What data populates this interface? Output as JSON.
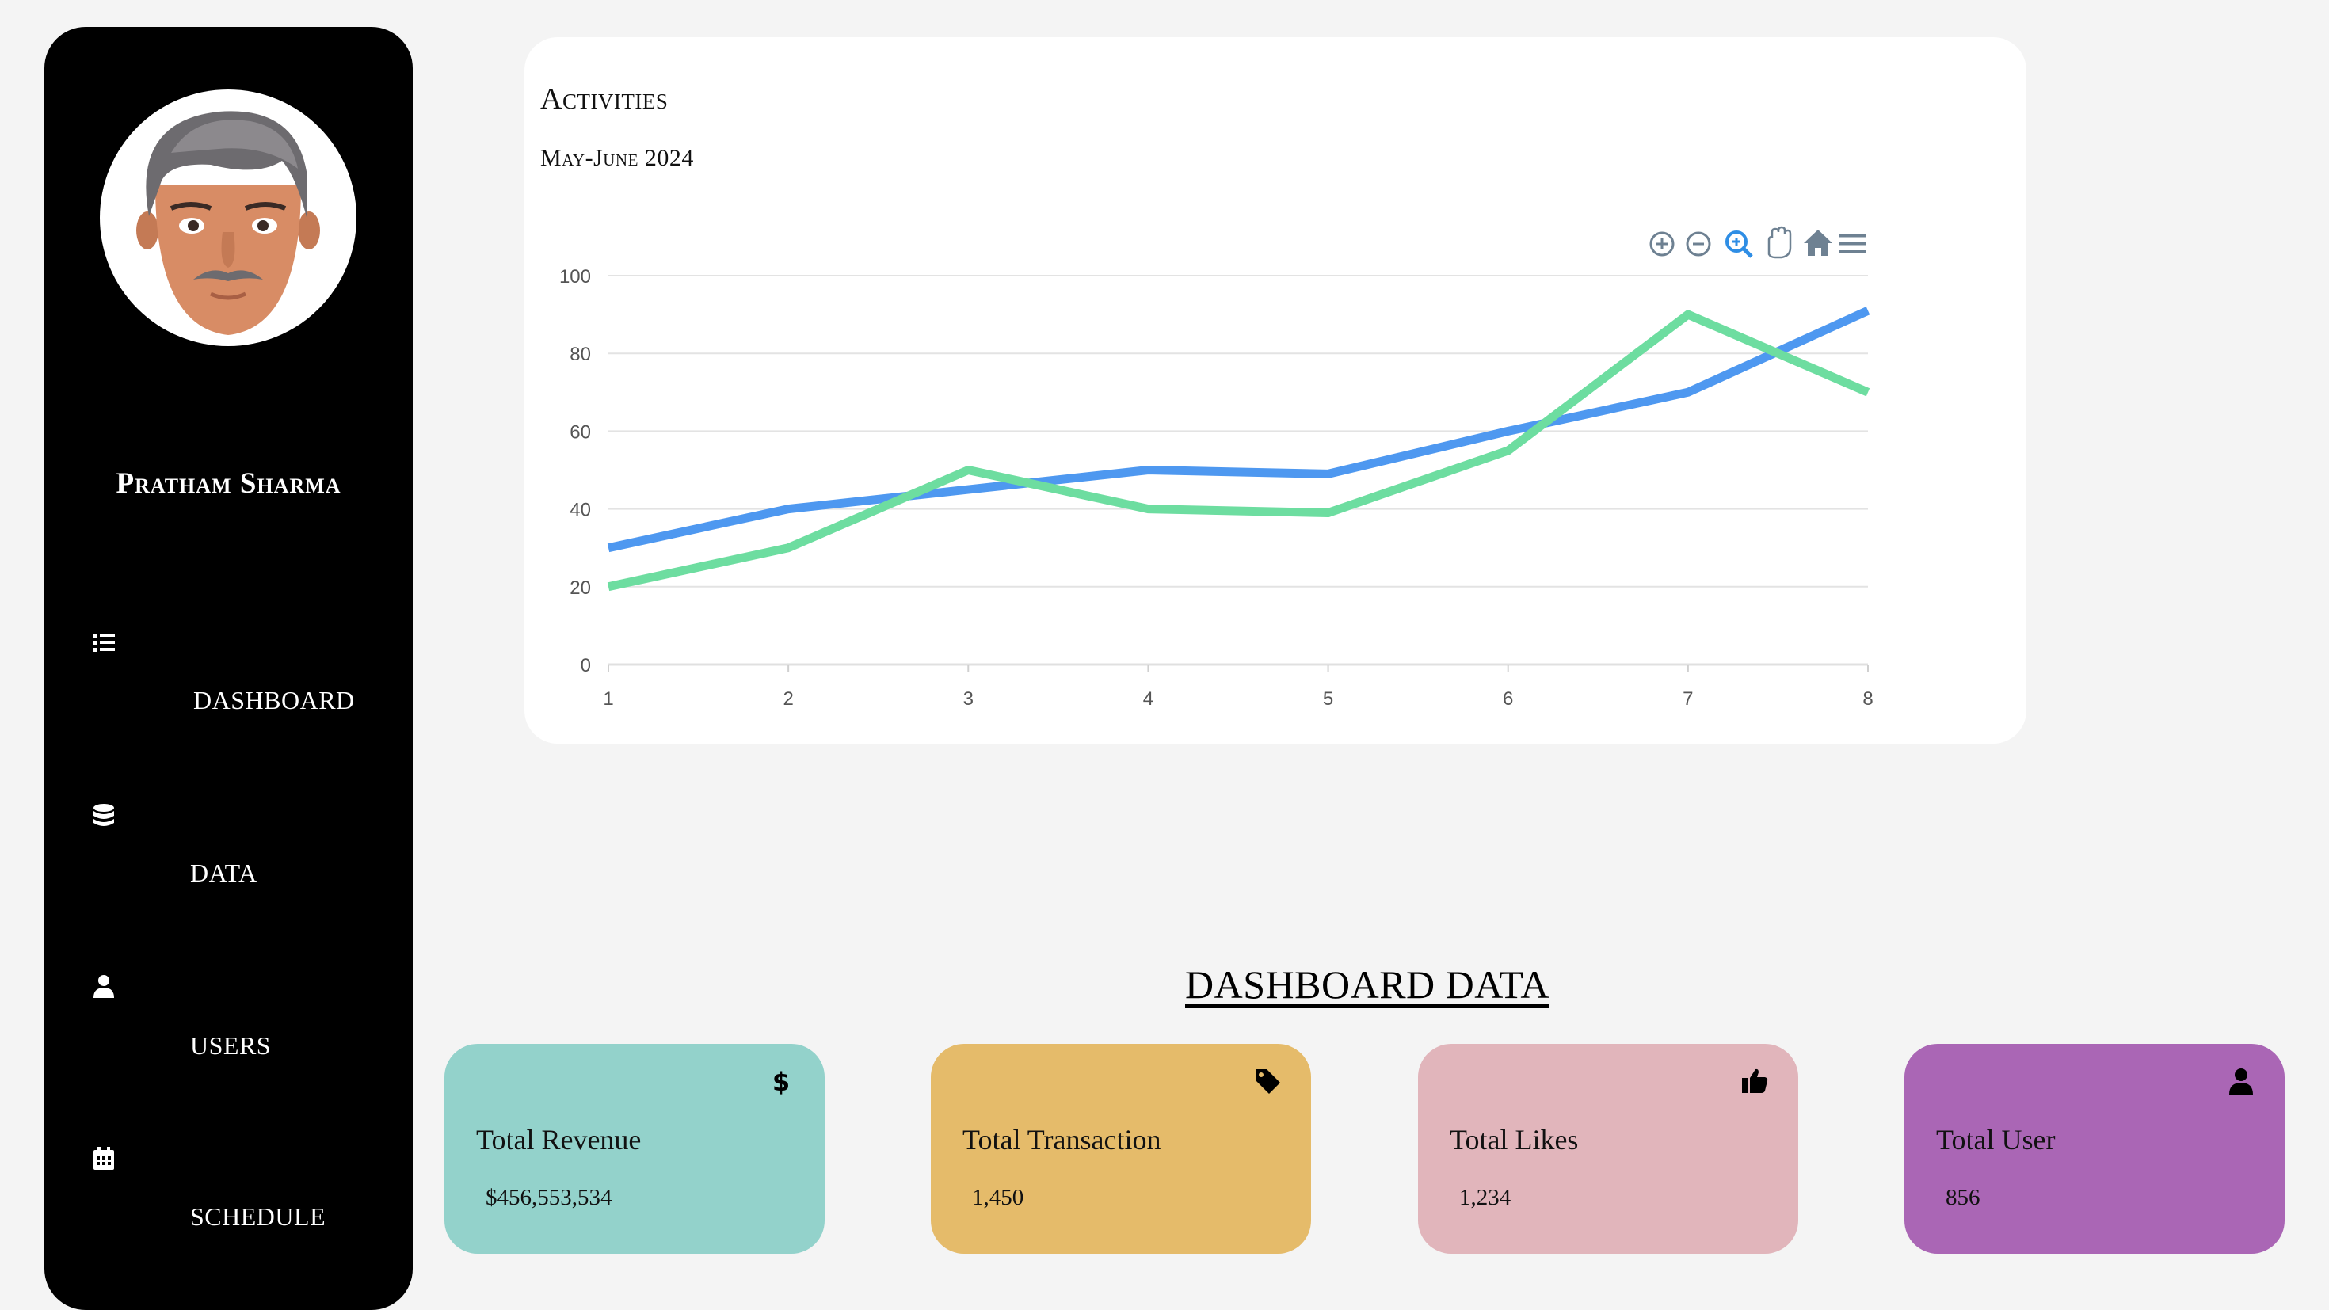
{
  "sidebar": {
    "profile_name": "Pratham Sharma",
    "items": [
      {
        "label": "DASHBOARD",
        "icon": "list-icon"
      },
      {
        "label": "DATA",
        "icon": "database-icon"
      },
      {
        "label": "USERS",
        "icon": "user-icon"
      },
      {
        "label": "SCHEDULE",
        "icon": "calendar-icon"
      }
    ]
  },
  "chart": {
    "title": "Activities",
    "subtitle": "May-June 2024",
    "toolbar": [
      "zoom-in-icon",
      "zoom-out-icon",
      "selection-zoom-icon",
      "pan-hand-icon",
      "home-reset-icon",
      "menu-icon"
    ]
  },
  "chart_data": {
    "type": "line",
    "x": [
      1,
      2,
      3,
      4,
      5,
      6,
      7,
      8
    ],
    "series": [
      {
        "color": "#4e98f0",
        "values": [
          30,
          40,
          45,
          50,
          49,
          60,
          70,
          91
        ]
      },
      {
        "color": "#6ddda0",
        "values": [
          20,
          30,
          50,
          40,
          39,
          55,
          90,
          70
        ]
      }
    ],
    "ylim": [
      0,
      100
    ],
    "yticks": [
      0,
      20,
      40,
      60,
      80,
      100
    ],
    "grid": true,
    "legend": "none"
  },
  "dashboard": {
    "title": "DASHBOARD DATA",
    "cards": [
      {
        "label": "Total Revenue",
        "value": "$456,553,534",
        "icon": "dollar-icon",
        "color": "#93d2cb"
      },
      {
        "label": "Total Transaction",
        "value": "1,450",
        "icon": "tag-icon",
        "color": "#e5bb6a"
      },
      {
        "label": "Total Likes",
        "value": "1,234",
        "icon": "thumbs-up-icon",
        "color": "#e1b5bb"
      },
      {
        "label": "Total User",
        "value": "856",
        "icon": "user-icon",
        "color": "#aa66b5"
      }
    ]
  }
}
